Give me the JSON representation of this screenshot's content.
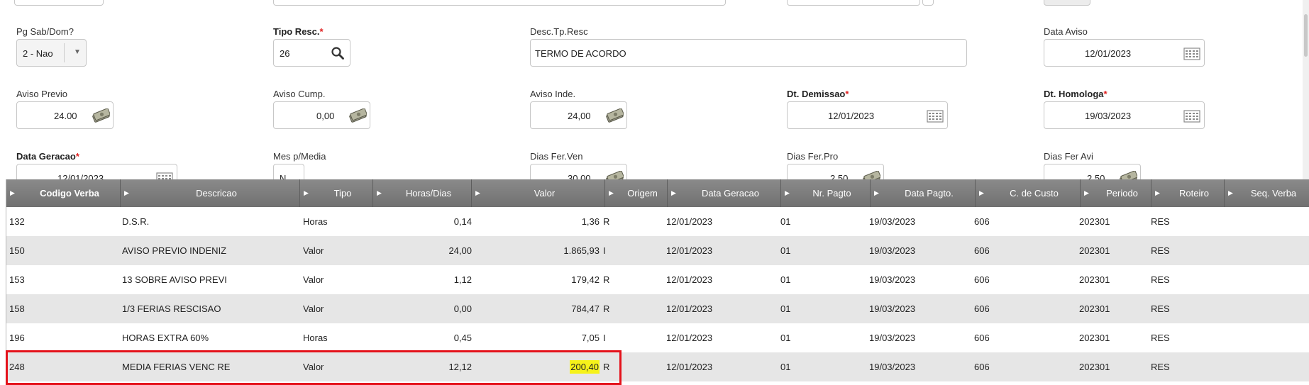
{
  "form": {
    "pg_sab_dom": {
      "label": "Pg Sab/Dom?",
      "value": "2 - Nao"
    },
    "tipo_resc": {
      "label": "Tipo Resc.",
      "required": "*",
      "value": "26"
    },
    "desc_tp_resc": {
      "label": "Desc.Tp.Resc",
      "value": "TERMO DE ACORDO"
    },
    "data_aviso": {
      "label": "Data Aviso",
      "value": "12/01/2023"
    },
    "aviso_previo": {
      "label": "Aviso Previo",
      "value": "24.00"
    },
    "aviso_cump": {
      "label": "Aviso Cump.",
      "value": "0,00"
    },
    "aviso_inde": {
      "label": "Aviso Inde.",
      "value": "24,00"
    },
    "dt_demissao": {
      "label": "Dt. Demissao",
      "required": "*",
      "value": "12/01/2023"
    },
    "dt_homologa": {
      "label": "Dt. Homologa",
      "required": "*",
      "value": "19/03/2023"
    },
    "data_geracao": {
      "label": "Data Geracao",
      "required": "*",
      "value": "12/01/2023"
    },
    "mes_p_media": {
      "label": "Mes p/Media",
      "value": "N"
    },
    "dias_fer_ven": {
      "label": "Dias Fer.Ven",
      "value": "30,00"
    },
    "dias_fer_pro": {
      "label": "Dias Fer.Pro",
      "value": "2,50"
    },
    "dias_fer_avi": {
      "label": "Dias Fer Avi",
      "value": "2,50"
    }
  },
  "grid": {
    "columns": [
      "Codigo Verba",
      "Descricao",
      "Tipo",
      "Horas/Dias",
      "Valor",
      "Origem",
      "Data Geracao",
      "Nr. Pagto",
      "Data Pagto.",
      "C. de Custo",
      "Periodo",
      "Roteiro",
      "Seq. Verba"
    ],
    "rows": [
      {
        "codigo": "132",
        "descricao": "D.S.R.",
        "tipo": "Horas",
        "horas": "0,14",
        "valor": "1,36",
        "origem": "R",
        "data_geracao": "12/01/2023",
        "nr_pagto": "01",
        "data_pagto": "19/03/2023",
        "custo": "606",
        "periodo": "202301",
        "roteiro": "RES"
      },
      {
        "codigo": "150",
        "descricao": "AVISO PREVIO INDENIZ",
        "tipo": "Valor",
        "horas": "24,00",
        "valor": "1.865,93",
        "origem": "I",
        "data_geracao": "12/01/2023",
        "nr_pagto": "01",
        "data_pagto": "19/03/2023",
        "custo": "606",
        "periodo": "202301",
        "roteiro": "RES"
      },
      {
        "codigo": "153",
        "descricao": "13 SOBRE AVISO PREVI",
        "tipo": "Valor",
        "horas": "1,12",
        "valor": "179,42",
        "origem": "R",
        "data_geracao": "12/01/2023",
        "nr_pagto": "01",
        "data_pagto": "19/03/2023",
        "custo": "606",
        "periodo": "202301",
        "roteiro": "RES"
      },
      {
        "codigo": "158",
        "descricao": "1/3 FERIAS RESCISAO",
        "tipo": "Valor",
        "horas": "0,00",
        "valor": "784,47",
        "origem": "R",
        "data_geracao": "12/01/2023",
        "nr_pagto": "01",
        "data_pagto": "19/03/2023",
        "custo": "606",
        "periodo": "202301",
        "roteiro": "RES"
      },
      {
        "codigo": "196",
        "descricao": "HORAS EXTRA 60%",
        "tipo": "Horas",
        "horas": "0,45",
        "valor": "7,05",
        "origem": "I",
        "data_geracao": "12/01/2023",
        "nr_pagto": "01",
        "data_pagto": "19/03/2023",
        "custo": "606",
        "periodo": "202301",
        "roteiro": "RES"
      },
      {
        "codigo": "248",
        "descricao": "MEDIA FERIAS VENC RE",
        "tipo": "Valor",
        "horas": "12,12",
        "valor": "200,40",
        "origem": "R",
        "data_geracao": "12/01/2023",
        "nr_pagto": "01",
        "data_pagto": "19/03/2023",
        "custo": "606",
        "periodo": "202301",
        "roteiro": "RES"
      }
    ]
  },
  "colors": {
    "header_bg": "#7c7c7c",
    "row_alt": "#e6e6e6",
    "highlight": "#f6f21a",
    "annotation_red": "#e4121b",
    "required_star": "#e02020"
  },
  "icons": {
    "search": "search-icon",
    "calendar": "calendar-icon",
    "money": "money-icon",
    "dropdown": "chevron-down-icon",
    "sort": "sort-arrow-icon"
  }
}
